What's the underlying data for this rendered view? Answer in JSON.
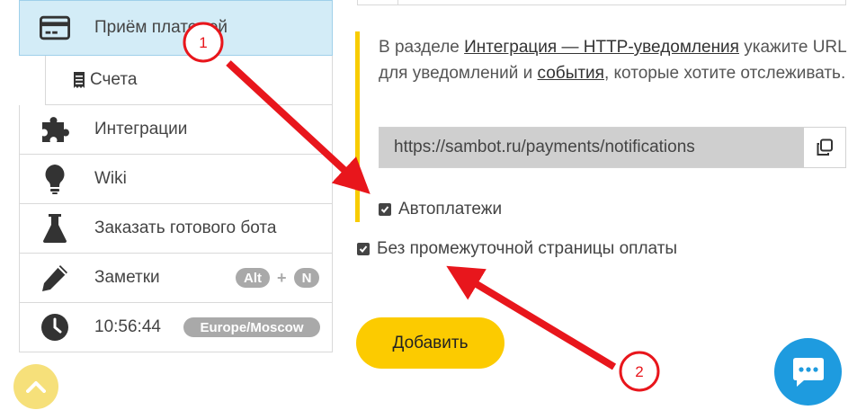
{
  "sidebar": {
    "items": [
      {
        "label": "Приём платежей",
        "icon": "credit-card-icon"
      },
      {
        "label": "Счета",
        "icon": "receipt-icon"
      },
      {
        "label": "Интеграции",
        "icon": "puzzle-icon"
      },
      {
        "label": "Wiki",
        "icon": "lightbulb-icon"
      },
      {
        "label": "Заказать готового бота",
        "icon": "flask-icon"
      },
      {
        "label": "Заметки",
        "icon": "pencil-icon",
        "shortcut": [
          "Alt",
          "+",
          "N"
        ]
      },
      {
        "label": "10:56:44",
        "icon": "clock-icon",
        "badge": "Europe/Moscow"
      }
    ]
  },
  "notice": {
    "part1": "В разделе ",
    "link1": "Интеграция — HTTP-уведомления",
    "part2": " укажите URL для уведомлений и ",
    "link2": "события",
    "part3": ", которые хотите отслеживать."
  },
  "url": {
    "value": "https://sambot.ru/payments/notifications"
  },
  "checkbox_autopay": {
    "label": "Автоплатежи",
    "checked": true
  },
  "checkbox_nointer": {
    "label": "Без промежуточной страницы оплаты",
    "checked": true
  },
  "add_button": {
    "label": "Добавить"
  },
  "annotations": {
    "marker1": "1",
    "marker2": "2",
    "color": "#e8161c"
  },
  "colors": {
    "accent_yellow": "#fccb00",
    "chat_blue": "#1e9bdf",
    "active_bg": "#d3ecf7"
  }
}
